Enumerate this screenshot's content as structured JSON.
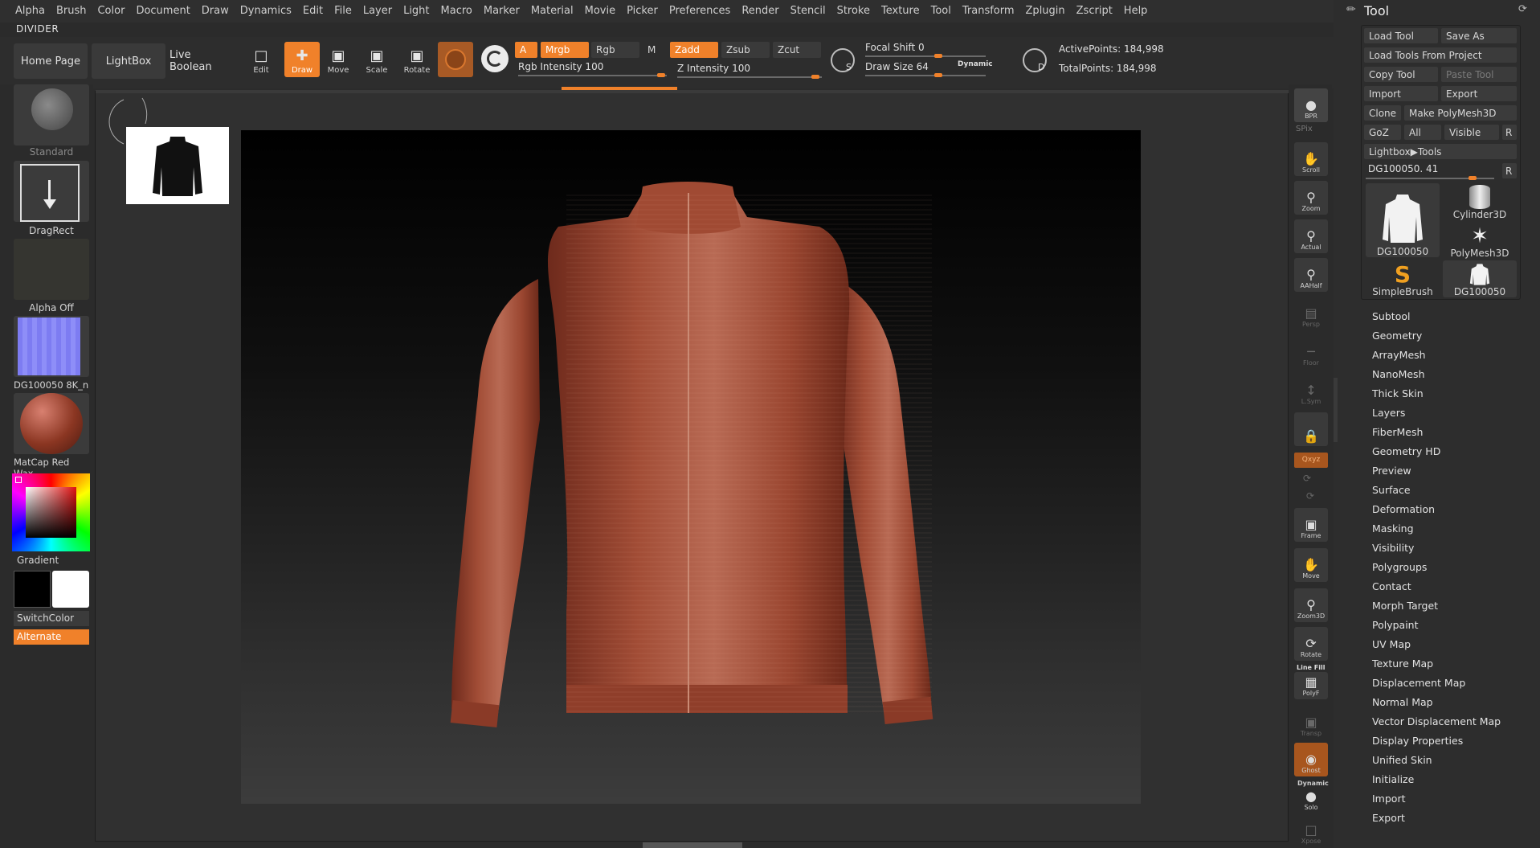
{
  "menu": [
    "Alpha",
    "Brush",
    "Color",
    "Document",
    "Draw",
    "Dynamics",
    "Edit",
    "File",
    "Layer",
    "Light",
    "Macro",
    "Marker",
    "Material",
    "Movie",
    "Picker",
    "Preferences",
    "Render",
    "Stencil",
    "Stroke",
    "Texture",
    "Tool",
    "Transform",
    "Zplugin",
    "Zscript",
    "Help"
  ],
  "divider_label": "DIVIDER",
  "shelf": {
    "home_page": "Home Page",
    "lightbox": "LightBox",
    "live_boolean": "Live Boolean",
    "edit": "Edit",
    "draw": "Draw",
    "move": "Move",
    "scale": "Scale",
    "rotate": "Rotate",
    "a": "A",
    "mrgb": "Mrgb",
    "rgb": "Rgb",
    "m": "M",
    "zadd": "Zadd",
    "zsub": "Zsub",
    "zcut": "Zcut",
    "rgb_intensity": "Rgb Intensity 100",
    "z_intensity": "Z Intensity 100",
    "focal_shift": "Focal Shift 0",
    "draw_size": "Draw Size 64",
    "dynamic": "Dynamic",
    "s_label": "S",
    "d_label": "D",
    "active_points": "ActivePoints: 184,998",
    "total_points": "TotalPoints: 184,998"
  },
  "left": {
    "brush": "Standard",
    "stroke": "DragRect",
    "alpha": "Alpha Off",
    "texture": "DG100050 8K_n",
    "material": "MatCap Red Wax",
    "gradient": "Gradient",
    "switchcolor": "SwitchColor",
    "alternate": "Alternate"
  },
  "rightbar": {
    "bpr": "BPR",
    "spix": "SPix",
    "scroll": "Scroll",
    "zoom": "Zoom",
    "actual": "Actual",
    "aahalf": "AAHalf",
    "persp": "Persp",
    "floor": "Floor",
    "lsym": "L.Sym",
    "qxyz": "Qxyz",
    "frame": "Frame",
    "move": "Move",
    "zoom3d": "Zoom3D",
    "rotate": "Rotate",
    "line_fill": "Line Fill",
    "polyf": "PolyF",
    "transp": "Transp",
    "ghost": "Ghost",
    "dynamic": "Dynamic",
    "solo": "Solo",
    "xpose": "Xpose"
  },
  "tool": {
    "title": "Tool",
    "load_tool": "Load Tool",
    "save_as": "Save As",
    "load_from_project": "Load Tools From Project",
    "copy_tool": "Copy Tool",
    "paste_tool": "Paste Tool",
    "import": "Import",
    "export": "Export",
    "clone": "Clone",
    "make_polymesh": "Make PolyMesh3D",
    "goz": "GoZ",
    "all": "All",
    "visible": "Visible",
    "r": "R",
    "lightbox_tools": "Lightbox▶Tools",
    "current_tool": "DG100050. 41",
    "r2": "R",
    "thumbs": [
      "DG100050",
      "Cylinder3D",
      "PolyMesh3D",
      "SimpleBrush",
      "DG100050"
    ],
    "sections": [
      "Subtool",
      "Geometry",
      "ArrayMesh",
      "NanoMesh",
      "Thick Skin",
      "Layers",
      "FiberMesh",
      "Geometry HD",
      "Preview",
      "Surface",
      "Deformation",
      "Masking",
      "Visibility",
      "Polygroups",
      "Contact",
      "Morph Target",
      "Polypaint",
      "UV Map",
      "Texture Map",
      "Displacement Map",
      "Normal Map",
      "Vector Displacement Map",
      "Display Properties",
      "Unified Skin",
      "Initialize",
      "Import",
      "Export"
    ]
  },
  "colors": {
    "accent": "#f0812a",
    "panel": "#2d2d2d",
    "button": "#3b3b3b",
    "jacket": "#9a4630"
  }
}
